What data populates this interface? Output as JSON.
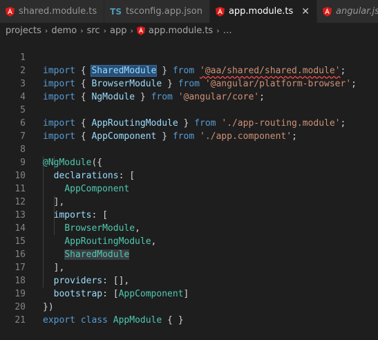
{
  "tabs": [
    {
      "label": "shared.module.ts",
      "icon": "angular-icon",
      "active": false,
      "italic": false
    },
    {
      "label": "tsconfig.app.json",
      "icon": "typescript-config-icon",
      "active": false,
      "italic": false
    },
    {
      "label": "app.module.ts",
      "icon": "angular-icon",
      "active": true,
      "italic": false
    },
    {
      "label": "angular.json",
      "icon": "angular-icon",
      "active": false,
      "italic": true
    }
  ],
  "tsconfig_icon_text": "TS",
  "close_symbol": "✕",
  "breadcrumb": {
    "items": [
      "projects",
      "demo",
      "src",
      "app"
    ],
    "file": "app.module.ts",
    "more": "…",
    "separator": "›"
  },
  "colors": {
    "keyword": "#569cd6",
    "class": "#4ec9b0",
    "string": "#ce9178",
    "property": "#9cdcfe",
    "angular_red": "#dd1b16",
    "error_squiggle": "#f14c4c"
  },
  "editor": {
    "line_numbers": [
      "1",
      "2",
      "3",
      "4",
      "5",
      "6",
      "7",
      "8",
      "9",
      "10",
      "11",
      "12",
      "13",
      "14",
      "15",
      "16",
      "17",
      "18",
      "19",
      "20",
      "21"
    ],
    "lines": [
      [
        "import",
        " { ",
        "SharedModule",
        " } ",
        "from",
        " ",
        "'@aa/shared/shared.module'",
        ";"
      ],
      [
        "import",
        " { ",
        "BrowserModule",
        " } ",
        "from",
        " ",
        "'@angular/platform-browser'",
        ";"
      ],
      [
        "import",
        " { ",
        "NgModule",
        " } ",
        "from",
        " ",
        "'@angular/core'",
        ";"
      ],
      [],
      [
        "import",
        " { ",
        "AppRoutingModule",
        " } ",
        "from",
        " ",
        "'./app-routing.module'",
        ";"
      ],
      [
        "import",
        " { ",
        "AppComponent",
        " } ",
        "from",
        " ",
        "'./app.component'",
        ";"
      ],
      [],
      [
        "@NgModule",
        "({"
      ],
      [
        "  ",
        "declarations",
        ": ["
      ],
      [
        "    ",
        "AppComponent"
      ],
      [
        "  ],"
      ],
      [
        "  ",
        "imports",
        ": ["
      ],
      [
        "    ",
        "BrowserModule",
        ","
      ],
      [
        "    ",
        "AppRoutingModule",
        ","
      ],
      [
        "    ",
        "SharedModule"
      ],
      [
        "  ],"
      ],
      [
        "  ",
        "providers",
        ": [],"
      ],
      [
        "  ",
        "bootstrap",
        ": [",
        "AppComponent",
        "]"
      ],
      [
        "})"
      ],
      [
        "export",
        " ",
        "class",
        " ",
        "AppModule",
        " { }"
      ],
      []
    ]
  }
}
